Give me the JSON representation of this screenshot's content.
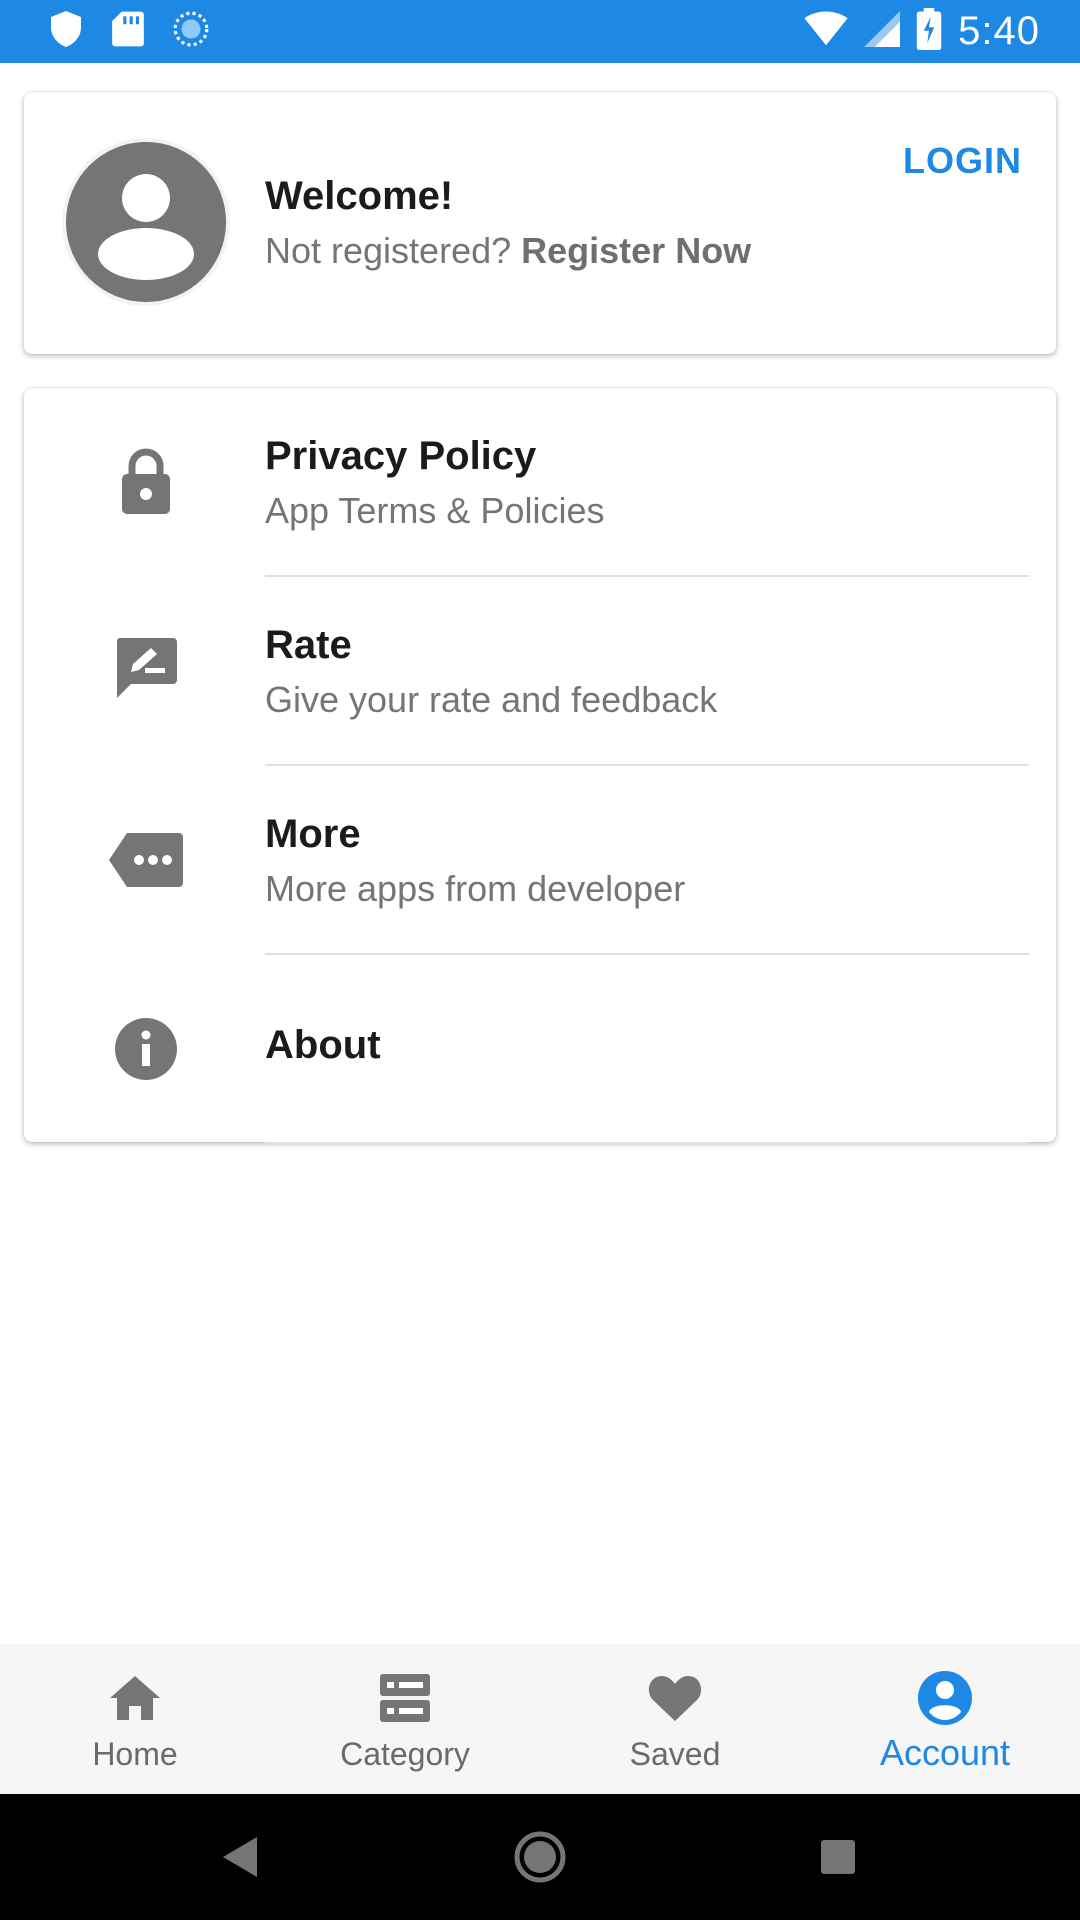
{
  "status_bar": {
    "time": "5:40",
    "icons": [
      "shield-icon",
      "sd-card-icon",
      "sync-icon",
      "wifi-icon",
      "signal-icon",
      "battery-charging-icon"
    ]
  },
  "profile": {
    "title": "Welcome!",
    "subtitle": "Not registered?",
    "register_label": "Register Now",
    "login_label": "LOGIN",
    "avatar_icon": "account-circle-icon"
  },
  "menu": {
    "items": [
      {
        "title": "Privacy Policy",
        "subtitle": "App Terms & Policies",
        "icon": "lock-icon"
      },
      {
        "title": "Rate",
        "subtitle": "Give your rate and feedback",
        "icon": "rate-review-icon"
      },
      {
        "title": "More",
        "subtitle": "More apps from developer",
        "icon": "more-label-icon"
      },
      {
        "title": "About",
        "subtitle": "",
        "icon": "info-icon"
      }
    ]
  },
  "bottom_nav": {
    "items": [
      {
        "label": "Home",
        "icon": "home-icon",
        "active": false
      },
      {
        "label": "Category",
        "icon": "category-icon",
        "active": false
      },
      {
        "label": "Saved",
        "icon": "heart-icon",
        "active": false
      },
      {
        "label": "Account",
        "icon": "account-icon",
        "active": true
      }
    ]
  },
  "colors": {
    "accent": "#1e88e5",
    "icon_gray": "#757575",
    "text_dark": "#1b1b1b"
  }
}
